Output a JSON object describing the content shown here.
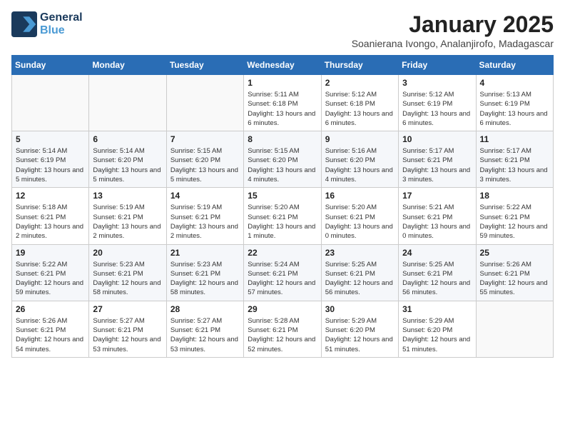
{
  "logo": {
    "line1": "General",
    "line2": "Blue"
  },
  "title": "January 2025",
  "location": "Soanierana Ivongo, Analanjirofo, Madagascar",
  "days_of_week": [
    "Sunday",
    "Monday",
    "Tuesday",
    "Wednesday",
    "Thursday",
    "Friday",
    "Saturday"
  ],
  "weeks": [
    [
      {
        "day": "",
        "content": ""
      },
      {
        "day": "",
        "content": ""
      },
      {
        "day": "",
        "content": ""
      },
      {
        "day": "1",
        "content": "Sunrise: 5:11 AM\nSunset: 6:18 PM\nDaylight: 13 hours and 6 minutes."
      },
      {
        "day": "2",
        "content": "Sunrise: 5:12 AM\nSunset: 6:18 PM\nDaylight: 13 hours and 6 minutes."
      },
      {
        "day": "3",
        "content": "Sunrise: 5:12 AM\nSunset: 6:19 PM\nDaylight: 13 hours and 6 minutes."
      },
      {
        "day": "4",
        "content": "Sunrise: 5:13 AM\nSunset: 6:19 PM\nDaylight: 13 hours and 6 minutes."
      }
    ],
    [
      {
        "day": "5",
        "content": "Sunrise: 5:14 AM\nSunset: 6:19 PM\nDaylight: 13 hours and 5 minutes."
      },
      {
        "day": "6",
        "content": "Sunrise: 5:14 AM\nSunset: 6:20 PM\nDaylight: 13 hours and 5 minutes."
      },
      {
        "day": "7",
        "content": "Sunrise: 5:15 AM\nSunset: 6:20 PM\nDaylight: 13 hours and 5 minutes."
      },
      {
        "day": "8",
        "content": "Sunrise: 5:15 AM\nSunset: 6:20 PM\nDaylight: 13 hours and 4 minutes."
      },
      {
        "day": "9",
        "content": "Sunrise: 5:16 AM\nSunset: 6:20 PM\nDaylight: 13 hours and 4 minutes."
      },
      {
        "day": "10",
        "content": "Sunrise: 5:17 AM\nSunset: 6:21 PM\nDaylight: 13 hours and 3 minutes."
      },
      {
        "day": "11",
        "content": "Sunrise: 5:17 AM\nSunset: 6:21 PM\nDaylight: 13 hours and 3 minutes."
      }
    ],
    [
      {
        "day": "12",
        "content": "Sunrise: 5:18 AM\nSunset: 6:21 PM\nDaylight: 13 hours and 2 minutes."
      },
      {
        "day": "13",
        "content": "Sunrise: 5:19 AM\nSunset: 6:21 PM\nDaylight: 13 hours and 2 minutes."
      },
      {
        "day": "14",
        "content": "Sunrise: 5:19 AM\nSunset: 6:21 PM\nDaylight: 13 hours and 2 minutes."
      },
      {
        "day": "15",
        "content": "Sunrise: 5:20 AM\nSunset: 6:21 PM\nDaylight: 13 hours and 1 minute."
      },
      {
        "day": "16",
        "content": "Sunrise: 5:20 AM\nSunset: 6:21 PM\nDaylight: 13 hours and 0 minutes."
      },
      {
        "day": "17",
        "content": "Sunrise: 5:21 AM\nSunset: 6:21 PM\nDaylight: 13 hours and 0 minutes."
      },
      {
        "day": "18",
        "content": "Sunrise: 5:22 AM\nSunset: 6:21 PM\nDaylight: 12 hours and 59 minutes."
      }
    ],
    [
      {
        "day": "19",
        "content": "Sunrise: 5:22 AM\nSunset: 6:21 PM\nDaylight: 12 hours and 59 minutes."
      },
      {
        "day": "20",
        "content": "Sunrise: 5:23 AM\nSunset: 6:21 PM\nDaylight: 12 hours and 58 minutes."
      },
      {
        "day": "21",
        "content": "Sunrise: 5:23 AM\nSunset: 6:21 PM\nDaylight: 12 hours and 58 minutes."
      },
      {
        "day": "22",
        "content": "Sunrise: 5:24 AM\nSunset: 6:21 PM\nDaylight: 12 hours and 57 minutes."
      },
      {
        "day": "23",
        "content": "Sunrise: 5:25 AM\nSunset: 6:21 PM\nDaylight: 12 hours and 56 minutes."
      },
      {
        "day": "24",
        "content": "Sunrise: 5:25 AM\nSunset: 6:21 PM\nDaylight: 12 hours and 56 minutes."
      },
      {
        "day": "25",
        "content": "Sunrise: 5:26 AM\nSunset: 6:21 PM\nDaylight: 12 hours and 55 minutes."
      }
    ],
    [
      {
        "day": "26",
        "content": "Sunrise: 5:26 AM\nSunset: 6:21 PM\nDaylight: 12 hours and 54 minutes."
      },
      {
        "day": "27",
        "content": "Sunrise: 5:27 AM\nSunset: 6:21 PM\nDaylight: 12 hours and 53 minutes."
      },
      {
        "day": "28",
        "content": "Sunrise: 5:27 AM\nSunset: 6:21 PM\nDaylight: 12 hours and 53 minutes."
      },
      {
        "day": "29",
        "content": "Sunrise: 5:28 AM\nSunset: 6:21 PM\nDaylight: 12 hours and 52 minutes."
      },
      {
        "day": "30",
        "content": "Sunrise: 5:29 AM\nSunset: 6:20 PM\nDaylight: 12 hours and 51 minutes."
      },
      {
        "day": "31",
        "content": "Sunrise: 5:29 AM\nSunset: 6:20 PM\nDaylight: 12 hours and 51 minutes."
      },
      {
        "day": "",
        "content": ""
      }
    ]
  ]
}
